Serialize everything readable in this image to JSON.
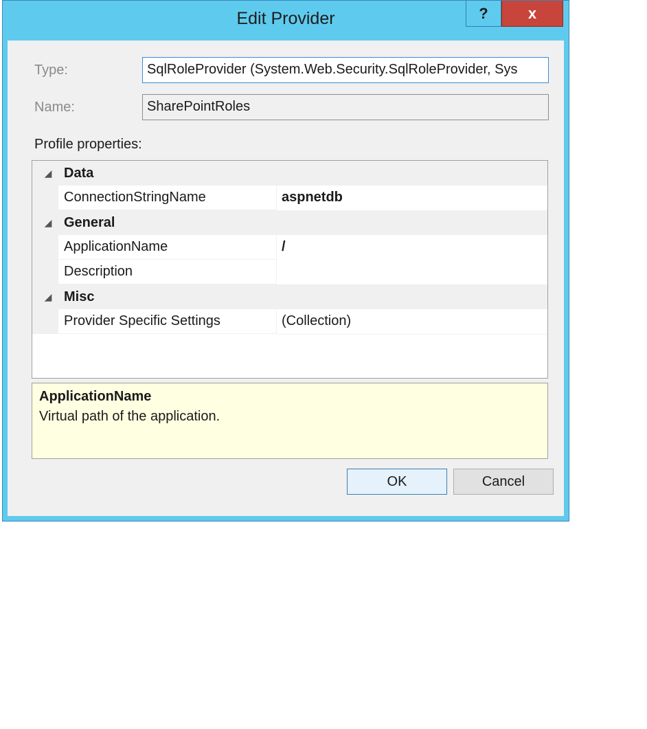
{
  "window": {
    "title": "Edit Provider",
    "help_label": "?",
    "close_label": "x"
  },
  "form": {
    "type_label": "Type:",
    "type_value": "SqlRoleProvider (System.Web.Security.SqlRoleProvider, Sys",
    "name_label": "Name:",
    "name_value": "SharePointRoles",
    "section_label": "Profile properties:"
  },
  "property_grid": {
    "categories": [
      {
        "label": "Data",
        "expand_glyph": "◢",
        "properties": [
          {
            "name": "ConnectionStringName",
            "value": "aspnetdb",
            "value_bold": true
          }
        ]
      },
      {
        "label": "General",
        "expand_glyph": "◢",
        "properties": [
          {
            "name": "ApplicationName",
            "value": "/",
            "value_bold": true
          },
          {
            "name": "Description",
            "value": "",
            "value_bold": false
          }
        ]
      },
      {
        "label": "Misc",
        "expand_glyph": "◢",
        "properties": [
          {
            "name": "Provider Specific Settings",
            "value": "(Collection)",
            "value_bold": false
          }
        ]
      }
    ]
  },
  "description": {
    "title": "ApplicationName",
    "text": "Virtual path of the application."
  },
  "buttons": {
    "ok_label": "OK",
    "cancel_label": "Cancel"
  },
  "colors": {
    "title_bar": "#5ecbee",
    "close_button": "#c7453a",
    "description_bg": "#ffffe1",
    "dialog_bg": "#f0f0f0"
  }
}
